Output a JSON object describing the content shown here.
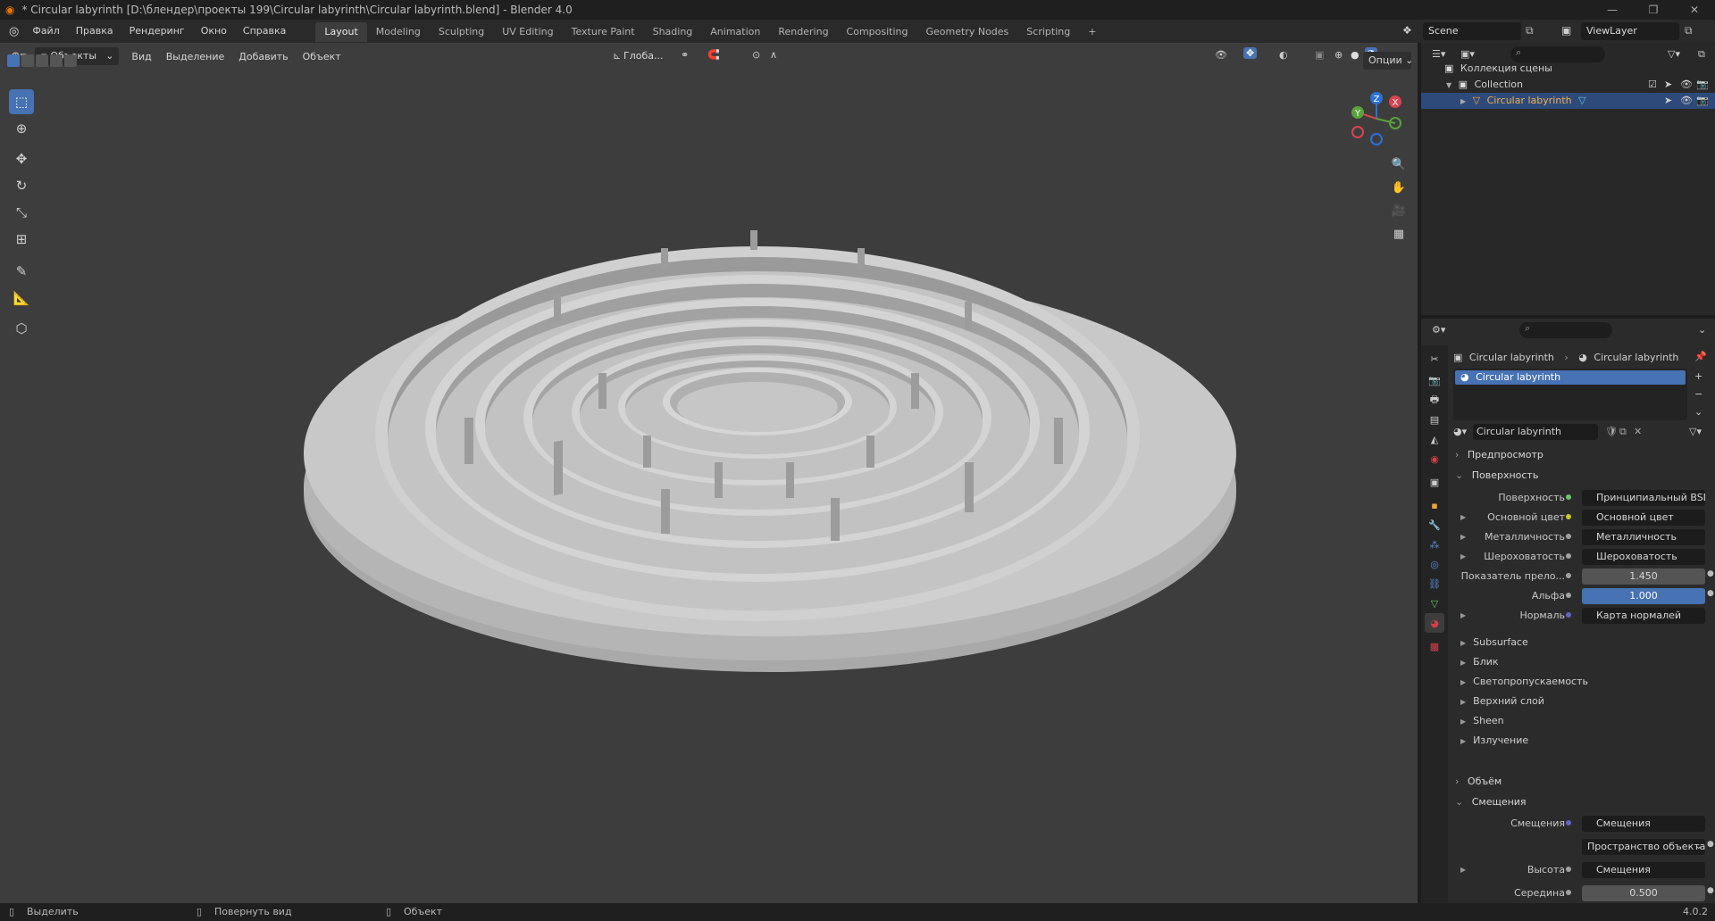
{
  "window": {
    "title": "* Circular labyrinth [D:\\блендер\\проекты 199\\Circular labyrinth\\Circular labyrinth.blend] - Blender 4.0",
    "controls": [
      "—",
      "❐",
      "✕"
    ]
  },
  "menu": [
    "Файл",
    "Правка",
    "Рендеринг",
    "Окно",
    "Справка"
  ],
  "workspaces": {
    "tabs": [
      "Layout",
      "Modeling",
      "Sculpting",
      "UV Editing",
      "Texture Paint",
      "Shading",
      "Animation",
      "Rendering",
      "Compositing",
      "Geometry Nodes",
      "Scripting"
    ],
    "active": "Layout",
    "add": "+"
  },
  "scene": {
    "name": "Scene",
    "view_layer": "ViewLayer"
  },
  "viewport": {
    "mode": "Объекты",
    "menus": [
      "Вид",
      "Выделение",
      "Добавить",
      "Объект"
    ],
    "orientation": "Глоба...",
    "options_label": "Опции",
    "gizmo": {
      "z": "Z",
      "y": "Y",
      "x": "X"
    }
  },
  "outliner": {
    "root": "Коллекция сцены",
    "collection": "Collection",
    "object": "Circular labyrinth"
  },
  "properties": {
    "breadcrumb": [
      "Circular labyrinth",
      "Circular labyrinth"
    ],
    "material_slot": "Circular labyrinth",
    "material_name": "Circular labyrinth",
    "panels": {
      "preview": "Предпросмотр",
      "surface": "Поверхность",
      "volume": "Объём",
      "displacement": "Смещения"
    },
    "surface_rows": [
      {
        "label": "Поверхность",
        "value": "Принципиальный BSDF",
        "dot": "#6ac46a",
        "arrow": false,
        "kind": "link"
      },
      {
        "label": "Основной цвет",
        "value": "Основной цвет",
        "dot": "#c7c729",
        "arrow": true,
        "kind": "link"
      },
      {
        "label": "Металличность",
        "value": "Металличность",
        "dot": "#a1a1a1",
        "arrow": true,
        "kind": "link"
      },
      {
        "label": "Шероховатость",
        "value": "Шероховатость",
        "dot": "#a1a1a1",
        "arrow": true,
        "kind": "link"
      },
      {
        "label": "Показатель прело...",
        "value": "1.450",
        "dot": "#a1a1a1",
        "arrow": false,
        "kind": "num"
      },
      {
        "label": "Альфа",
        "value": "1.000",
        "dot": "#a1a1a1",
        "arrow": false,
        "kind": "blue"
      },
      {
        "label": "Нормаль",
        "value": "Карта нормалей",
        "dot": "#6363c7",
        "arrow": true,
        "kind": "link"
      }
    ],
    "subpanels": [
      "Subsurface",
      "Блик",
      "Светопропускаемость",
      "Верхний слой",
      "Sheen",
      "Излучение"
    ],
    "displacement_rows": [
      {
        "label": "Смещения",
        "value": "Смещения",
        "dot": "#6363c7",
        "kind": "link"
      },
      {
        "label": "",
        "value": "Пространство объекта",
        "kind": "dropdown"
      },
      {
        "label": "Высота",
        "value": "Смещения",
        "dot": "#a1a1a1",
        "kind": "link"
      },
      {
        "label": "Середина",
        "value": "0.500",
        "dot": "#a1a1a1",
        "kind": "num"
      }
    ]
  },
  "status": {
    "items": [
      "Выделить",
      "Повернуть вид",
      "Объект"
    ],
    "version": "4.0.2"
  }
}
